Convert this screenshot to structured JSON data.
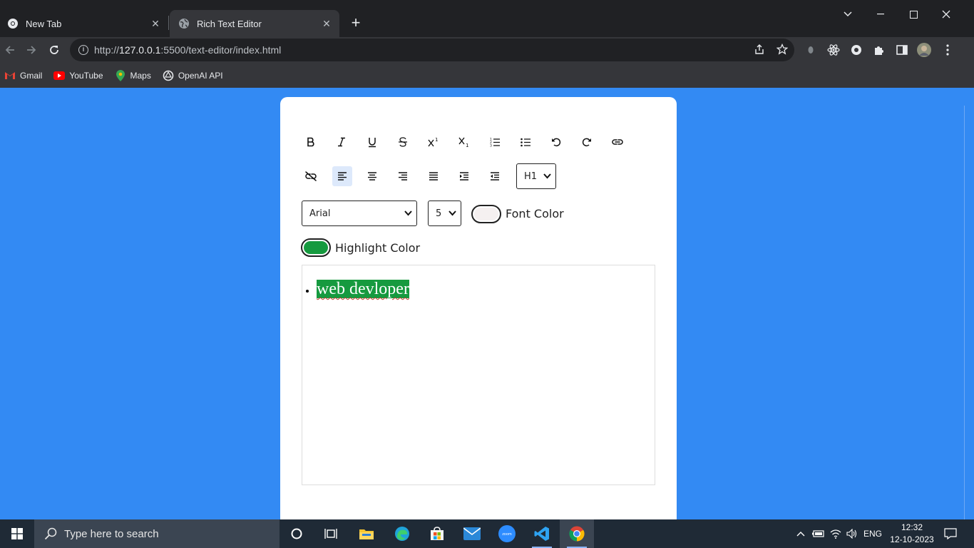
{
  "browser": {
    "tabs": [
      {
        "title": "New Tab",
        "active": false
      },
      {
        "title": "Rich Text Editor",
        "active": true
      }
    ],
    "url_prefix": "http://",
    "url_host": "127.0.0.1",
    "url_rest": ":5500/text-editor/index.html",
    "bookmarks": [
      {
        "label": "Gmail",
        "icon": "gmail-icon"
      },
      {
        "label": "YouTube",
        "icon": "youtube-icon"
      },
      {
        "label": "Maps",
        "icon": "maps-icon"
      },
      {
        "label": "OpenAI API",
        "icon": "openai-icon"
      }
    ]
  },
  "editor": {
    "toolbar_row1": [
      "bold",
      "italic",
      "underline",
      "strikethrough",
      "superscript",
      "subscript",
      "ordered-list",
      "unordered-list",
      "undo",
      "redo",
      "link"
    ],
    "toolbar_row2": [
      "unlink",
      "align-left",
      "align-center",
      "align-right",
      "justify",
      "indent",
      "outdent"
    ],
    "active_tool": "align-left",
    "heading_select": "H1",
    "font_select": "Arial",
    "size_select": "5",
    "font_color_label": "Font Color",
    "font_color": "#f5f0f0",
    "highlight_color_label": "Highlight Color",
    "highlight_color": "#169a3f",
    "content": "web devloper"
  },
  "taskbar": {
    "search_placeholder": "Type here to search",
    "language": "ENG",
    "time": "12:32",
    "date": "12-10-2023"
  },
  "colors": {
    "page_bg": "#338af3",
    "chrome_dark": "#202124",
    "chrome_toolbar": "#35363a",
    "taskbar": "#1f2a36"
  }
}
